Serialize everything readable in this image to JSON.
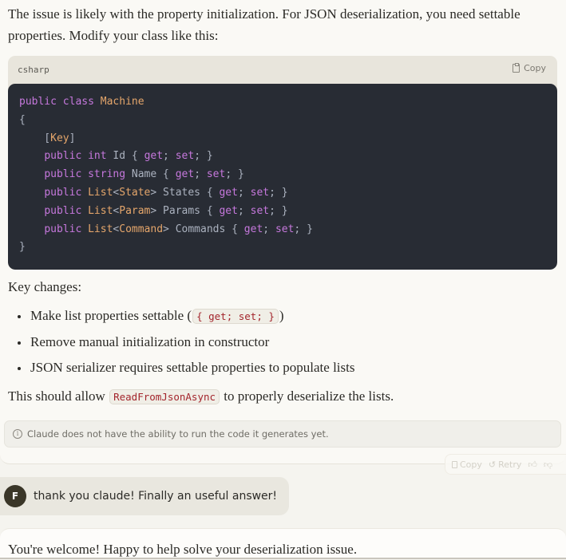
{
  "assistant": {
    "intro": "The issue is likely with the property initialization. For JSON deserialization, you need settable properties. Modify your class like this:",
    "code_block": {
      "language": "csharp",
      "copy_label": "Copy",
      "lines": [
        [
          {
            "t": "kw",
            "v": "public"
          },
          {
            "t": "pl",
            "v": " "
          },
          {
            "t": "kw",
            "v": "class"
          },
          {
            "t": "pl",
            "v": " "
          },
          {
            "t": "cl",
            "v": "Machine"
          }
        ],
        [
          {
            "t": "pl",
            "v": "{"
          }
        ],
        [
          {
            "t": "pl",
            "v": "    ["
          },
          {
            "t": "cl",
            "v": "Key"
          },
          {
            "t": "pl",
            "v": "]"
          }
        ],
        [
          {
            "t": "pl",
            "v": "    "
          },
          {
            "t": "kw",
            "v": "public"
          },
          {
            "t": "pl",
            "v": " "
          },
          {
            "t": "kw",
            "v": "int"
          },
          {
            "t": "pl",
            "v": " Id { "
          },
          {
            "t": "kw",
            "v": "get"
          },
          {
            "t": "pl",
            "v": "; "
          },
          {
            "t": "kw",
            "v": "set"
          },
          {
            "t": "pl",
            "v": "; }"
          }
        ],
        [
          {
            "t": "pl",
            "v": "    "
          },
          {
            "t": "kw",
            "v": "public"
          },
          {
            "t": "pl",
            "v": " "
          },
          {
            "t": "kw",
            "v": "string"
          },
          {
            "t": "pl",
            "v": " Name { "
          },
          {
            "t": "kw",
            "v": "get"
          },
          {
            "t": "pl",
            "v": "; "
          },
          {
            "t": "kw",
            "v": "set"
          },
          {
            "t": "pl",
            "v": "; }"
          }
        ],
        [
          {
            "t": "pl",
            "v": "    "
          },
          {
            "t": "kw",
            "v": "public"
          },
          {
            "t": "pl",
            "v": " "
          },
          {
            "t": "cl",
            "v": "List"
          },
          {
            "t": "pl",
            "v": "<"
          },
          {
            "t": "cl",
            "v": "State"
          },
          {
            "t": "pl",
            "v": "> States { "
          },
          {
            "t": "kw",
            "v": "get"
          },
          {
            "t": "pl",
            "v": "; "
          },
          {
            "t": "kw",
            "v": "set"
          },
          {
            "t": "pl",
            "v": "; }"
          }
        ],
        [
          {
            "t": "pl",
            "v": "    "
          },
          {
            "t": "kw",
            "v": "public"
          },
          {
            "t": "pl",
            "v": " "
          },
          {
            "t": "cl",
            "v": "List"
          },
          {
            "t": "pl",
            "v": "<"
          },
          {
            "t": "cl",
            "v": "Param"
          },
          {
            "t": "pl",
            "v": "> Params { "
          },
          {
            "t": "kw",
            "v": "get"
          },
          {
            "t": "pl",
            "v": "; "
          },
          {
            "t": "kw",
            "v": "set"
          },
          {
            "t": "pl",
            "v": "; }"
          }
        ],
        [
          {
            "t": "pl",
            "v": "    "
          },
          {
            "t": "kw",
            "v": "public"
          },
          {
            "t": "pl",
            "v": " "
          },
          {
            "t": "cl",
            "v": "List"
          },
          {
            "t": "pl",
            "v": "<"
          },
          {
            "t": "cl",
            "v": "Command"
          },
          {
            "t": "pl",
            "v": "> Commands { "
          },
          {
            "t": "kw",
            "v": "get"
          },
          {
            "t": "pl",
            "v": "; "
          },
          {
            "t": "kw",
            "v": "set"
          },
          {
            "t": "pl",
            "v": "; }"
          }
        ],
        [
          {
            "t": "pl",
            "v": "}"
          }
        ]
      ]
    },
    "key_changes_heading": "Key changes:",
    "bullets": [
      {
        "before": "Make list properties settable (",
        "code": "{ get; set; }",
        "after": ")"
      },
      {
        "before": "Remove manual initialization in constructor",
        "code": "",
        "after": ""
      },
      {
        "before": "JSON serializer requires settable properties to populate lists",
        "code": "",
        "after": ""
      }
    ],
    "closing": {
      "before": "This should allow ",
      "code": "ReadFromJsonAsync",
      "after": " to properly deserialize the lists."
    },
    "notice": "Claude does not have the ability to run the code it generates yet.",
    "actions": {
      "copy_label": "Copy",
      "retry_label": "Retry"
    }
  },
  "user_message": {
    "avatar_initial": "F",
    "text": "thank you claude! Finally an useful answer!"
  },
  "reply": {
    "text": "You're welcome! Happy to help solve your deserialization issue."
  },
  "colors": {
    "code_bg": "#282c34",
    "keyword": "#c678dd",
    "class_name": "#e5a66b",
    "inline_code": "#a3252c",
    "avatar_bg": "#3a3628"
  }
}
